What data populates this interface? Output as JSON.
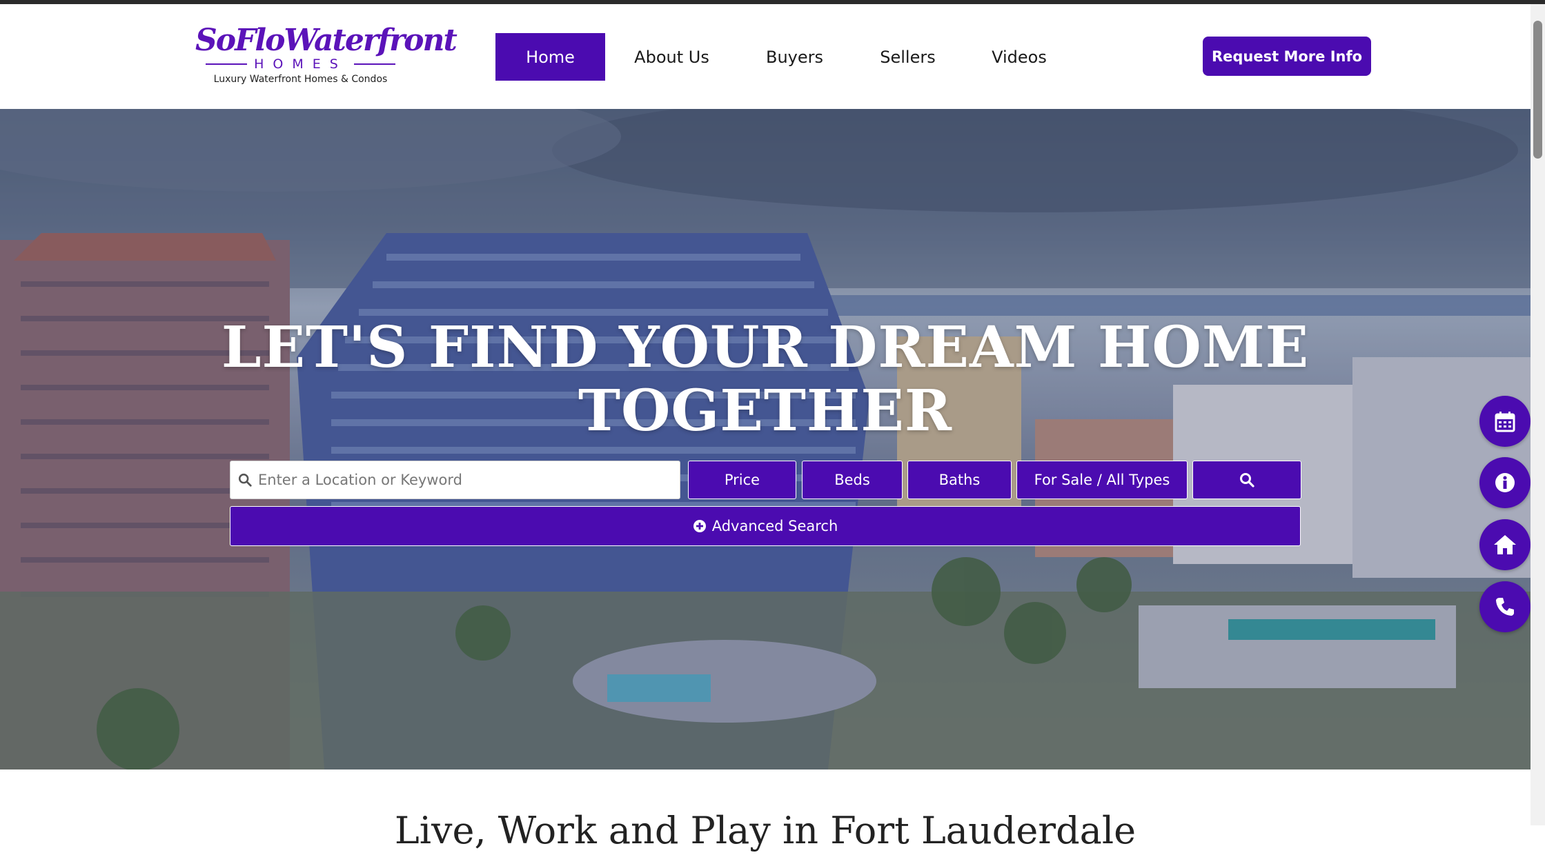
{
  "logo": {
    "script": "SoFloWaterfront",
    "homes": "HOMES",
    "tagline": "Luxury Waterfront Homes & Condos"
  },
  "nav": {
    "items": [
      {
        "label": "Home",
        "active": true
      },
      {
        "label": "About Us",
        "active": false
      },
      {
        "label": "Buyers",
        "active": false
      },
      {
        "label": "Sellers",
        "active": false
      },
      {
        "label": "Videos",
        "active": false
      }
    ],
    "cta": "Request More Info"
  },
  "hero": {
    "title_line1": "LET'S FIND YOUR DREAM HOME",
    "title_line2": "TOGETHER"
  },
  "search": {
    "placeholder": "Enter a Location or Keyword",
    "price_label": "Price",
    "beds_label": "Beds",
    "baths_label": "Baths",
    "type_label": "For Sale / All Types",
    "advanced_label": "Advanced Search"
  },
  "floating_buttons": [
    {
      "icon": "calendar-icon"
    },
    {
      "icon": "info-icon"
    },
    {
      "icon": "home-icon"
    },
    {
      "icon": "phone-icon"
    }
  ],
  "next_section": {
    "heading": "Live, Work and Play in Fort Lauderdale"
  },
  "colors": {
    "brand_purple": "#4b0bb0",
    "logo_purple": "#5b13b9",
    "white": "#ffffff"
  }
}
